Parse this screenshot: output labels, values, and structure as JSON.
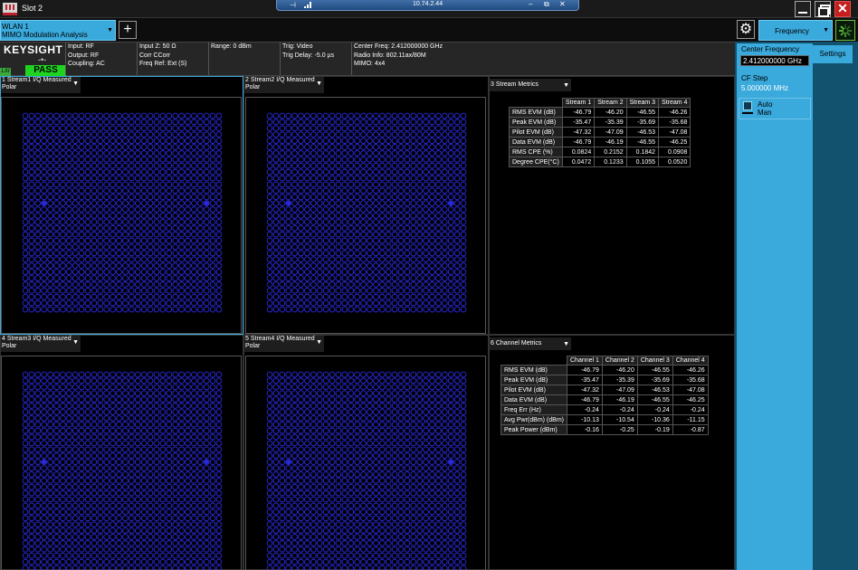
{
  "window": {
    "title": "Slot 2"
  },
  "remote": {
    "ip": "10.74.2.44",
    "pin": "⊣",
    "btn_min": "–",
    "btn_restore": "⧉",
    "btn_close": "✕"
  },
  "mode_tab": {
    "line1": "WLAN 1",
    "line2": "MIMO Modulation Analysis",
    "add_label": "+"
  },
  "menu": {
    "frequency_label": "Frequency",
    "gear_icon": "gear-icon"
  },
  "instrument": {
    "brand": "KEYSIGHT",
    "brand_symbol": "-•-",
    "lxi": "LXI",
    "status": "PASS",
    "status_color": "#21d321",
    "accent_color": "#3aa9db",
    "info": [
      [
        "Input: RF",
        "Output: RF",
        "Coupling: AC"
      ],
      [
        "Input Z: 50 Ω",
        "Corr CCorr",
        "Freq Ref: Ext (S)"
      ],
      [
        "Range: 0 dBm",
        "",
        ""
      ],
      [
        "Trig: Video",
        "Trig Delay: -5.0 µs",
        ""
      ],
      [
        "Center Freq: 2.412000000 GHz",
        "Radio Info: 802.11ax/80M",
        "MIMO: 4x4"
      ]
    ]
  },
  "windows": {
    "w1": {
      "title": "1 Stream1 I/Q Measured",
      "sub": "Polar"
    },
    "w2": {
      "title": "2 Stream2 I/Q Measured",
      "sub": "Polar"
    },
    "w3": {
      "title": "3 Stream Metrics"
    },
    "w4": {
      "title": "4 Stream3 I/Q Measured",
      "sub": "Polar"
    },
    "w5": {
      "title": "5 Stream4 I/Q Measured",
      "sub": "Polar"
    },
    "w6": {
      "title": "6 Channel Metrics"
    }
  },
  "constellation": {
    "grid": 32,
    "point_color": "#2a2ae0"
  },
  "stream_metrics": {
    "columns": [
      "Stream 1",
      "Stream 2",
      "Stream 3",
      "Stream 4"
    ],
    "rows": [
      [
        "RMS EVM (dB)",
        "-46.79",
        "-46.20",
        "-46.55",
        "-46.26"
      ],
      [
        "Peak EVM (dB)",
        "-35.47",
        "-35.39",
        "-35.69",
        "-35.68"
      ],
      [
        "Pilot EVM (dB)",
        "-47.32",
        "-47.09",
        "-46.53",
        "-47.08"
      ],
      [
        "Data EVM (dB)",
        "-46.79",
        "-46.19",
        "-46.55",
        "-46.25"
      ],
      [
        "RMS CPE (%)",
        "0.0824",
        "0.2152",
        "0.1842",
        "0.0908"
      ],
      [
        "Degree CPE(°C)",
        "0.0472",
        "0.1233",
        "0.1055",
        "0.0520"
      ]
    ]
  },
  "channel_metrics": {
    "columns": [
      "Channel 1",
      "Channel 2",
      "Channel 3",
      "Channel 4"
    ],
    "rows": [
      [
        "RMS EVM (dB)",
        "-46.79",
        "-46.20",
        "-46.55",
        "-46.26"
      ],
      [
        "Peak EVM (dB)",
        "-35.47",
        "-35.39",
        "-35.69",
        "-35.68"
      ],
      [
        "Pilot EVM (dB)",
        "-47.32",
        "-47.09",
        "-46.53",
        "-47.08"
      ],
      [
        "Data EVM (dB)",
        "-46.79",
        "-46.19",
        "-46.55",
        "-46.25"
      ],
      [
        "Freq Err (Hz)",
        "-0.24",
        "-0.24",
        "-0.24",
        "-0.24"
      ],
      [
        "Avg Pwr(dBm) (dBm)",
        "-10.13",
        "-10.54",
        "-10.36",
        "-11.15"
      ],
      [
        "Peak Power (dBm)",
        "-0.16",
        "-0.25",
        "-0.19",
        "-0.87"
      ]
    ]
  },
  "side_panel": {
    "center_freq_label": "Center Frequency",
    "center_freq_value": "2.412000000 GHz",
    "cf_step_label": "CF Step",
    "cf_step_value": "5.000000 MHz",
    "auto_label": "Auto",
    "man_label": "Man",
    "settings_tab": "Settings"
  }
}
